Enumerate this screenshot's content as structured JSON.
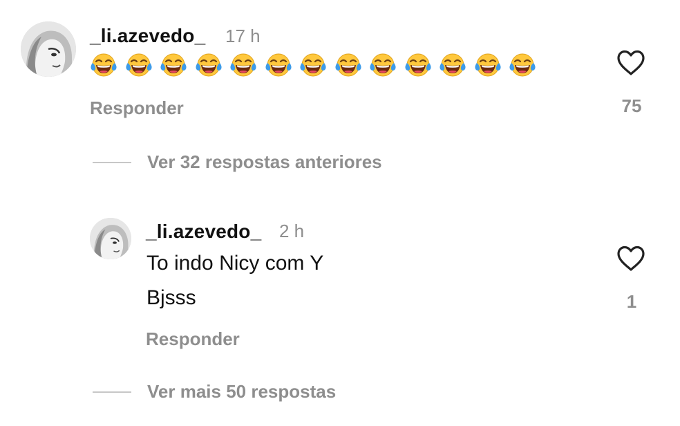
{
  "comment": {
    "username": "_li.azevedo_",
    "time": "17 h",
    "emoji_count": 13,
    "emoji_name": "face-with-tears-of-joy",
    "reply_label": "Responder",
    "like_count": "75",
    "like_icon": "heart-outline-icon"
  },
  "view_previous_replies": "Ver 32 respostas anteriores",
  "reply": {
    "username": "_li.azevedo_",
    "time": "2 h",
    "text_lines": [
      "To indo Nicy com Y",
      "Bjsss"
    ],
    "reply_label": "Responder",
    "like_count": "1",
    "like_icon": "heart-outline-icon"
  },
  "view_more_replies": "Ver mais 50 respostas",
  "colors": {
    "primary_text": "#111111",
    "secondary_text": "#8e8e8e",
    "divider": "#c7c7c7",
    "emoji_face": "#ffc83d",
    "emoji_tears": "#3d9be9"
  }
}
